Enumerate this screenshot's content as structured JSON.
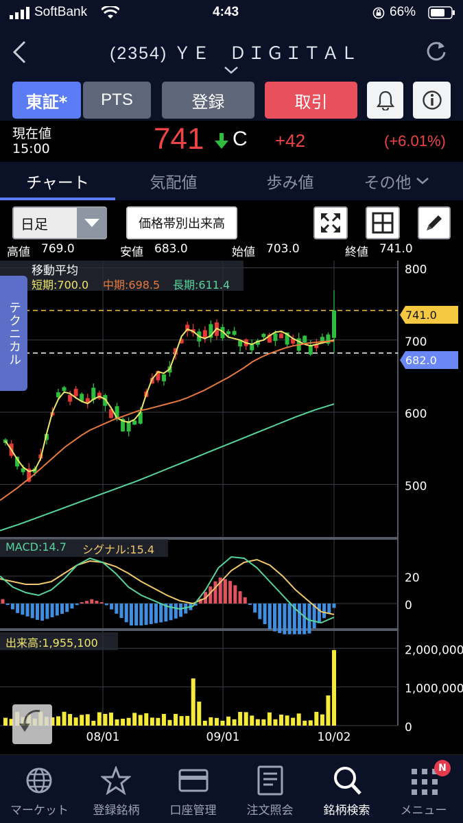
{
  "status": {
    "carrier": "SoftBank",
    "time": "4:43",
    "battery": "66%"
  },
  "nav": {
    "title": "(2354) ＹＥ　ＤＩＧＩＴＡＬ"
  },
  "buttons": {
    "market": "東証*",
    "pts": "PTS",
    "register": "登録",
    "trade": "取引"
  },
  "price": {
    "label1": "現在値",
    "label2": "15:00",
    "value": "741",
    "mark": "C",
    "change": "+42",
    "change_pct": "(+6.01%)"
  },
  "tabs": [
    "チャート",
    "気配値",
    "歩み値",
    "その他"
  ],
  "chart_controls": {
    "period": "日足",
    "volume_by_price": "価格帯別出来高"
  },
  "ohlc": {
    "high_label": "高値",
    "high": "769.0",
    "low_label": "安値",
    "low": "683.0",
    "open_label": "始値",
    "open": "703.0",
    "close_label": "終値",
    "close": "741.0"
  },
  "ma": {
    "title": "移動平均",
    "short": "短期:700.0",
    "mid": "中期:698.5",
    "long": "長期:611.4"
  },
  "side_tab": "テクニカル",
  "price_tags": {
    "high": "741.0",
    "low": "682.0"
  },
  "colors": {
    "up": "#2fbd3f",
    "down": "#e53935",
    "short": "#f1e86a",
    "mid": "#e7793d",
    "long": "#56d69c",
    "accent_blue": "#5b7cf5",
    "trade_red": "#e8505b"
  },
  "macd": {
    "label": "MACD:14.7",
    "signal": "シグナル:15.4"
  },
  "volume": {
    "label": "出来高:1,955,100"
  },
  "chart_data": [
    {
      "type": "candlestick",
      "y_ticks": [
        "800",
        "700",
        "600",
        "500"
      ],
      "ylim": [
        430,
        810
      ],
      "x_ticks": [
        "08/01",
        "09/01",
        "10/02"
      ],
      "series": [
        {
          "name": "短期",
          "values": [
            560,
            548,
            535,
            524,
            518,
            520,
            536,
            570,
            600,
            618,
            628,
            626,
            620,
            615,
            612,
            618,
            622,
            618,
            606,
            592,
            588,
            586,
            590,
            600,
            625,
            646,
            656,
            654,
            660,
            682,
            705,
            715,
            712,
            705,
            702,
            706,
            716,
            712,
            704,
            702,
            700,
            696,
            694,
            698,
            700,
            706,
            711,
            712,
            708,
            702,
            698,
            694,
            692,
            694,
            696,
            698,
            700
          ]
        },
        {
          "name": "中期",
          "values": [
            478,
            486,
            494,
            503,
            512,
            522,
            532,
            542,
            552,
            560,
            568,
            575,
            580,
            585,
            590,
            594,
            598,
            602,
            604,
            607,
            610,
            613,
            616,
            620,
            625,
            630,
            636,
            642,
            648,
            655,
            662,
            670,
            676,
            681,
            685,
            689,
            692,
            694,
            696,
            697,
            698,
            698.5
          ]
        },
        {
          "name": "長期",
          "values": [
            436,
            445,
            455,
            465,
            475,
            485,
            495,
            505,
            516,
            527,
            538,
            549,
            560,
            571,
            582,
            593,
            603,
            611.4
          ]
        }
      ],
      "last_close": 741,
      "last_high": 769,
      "last_low": 683,
      "last_open": 703
    },
    {
      "type": "line",
      "name": "MACD",
      "y_ticks": [
        "20",
        "0"
      ],
      "values_macd": [
        20,
        12,
        8,
        6,
        10,
        18,
        28,
        33,
        30,
        22,
        12,
        6,
        2,
        -2,
        -4,
        -2,
        10,
        26,
        34,
        33,
        26,
        16,
        6,
        -4,
        -12,
        -14,
        -10
      ],
      "values_signal": [
        18,
        16,
        14,
        14,
        16,
        22,
        28,
        31,
        30,
        27,
        22,
        16,
        11,
        6,
        2,
        0,
        4,
        14,
        24,
        30,
        32,
        28,
        20,
        10,
        2,
        -6,
        -8
      ]
    },
    {
      "type": "bar",
      "name": "出来高",
      "y_ticks": [
        "2,000,000",
        "1,000,000",
        "0"
      ],
      "ylim": [
        0,
        2200000
      ],
      "last_value": 1955100
    }
  ],
  "bottom_nav": [
    "マーケット",
    "登録銘柄",
    "口座管理",
    "注文照会",
    "銘柄検索",
    "メニュー"
  ],
  "badge": "N"
}
